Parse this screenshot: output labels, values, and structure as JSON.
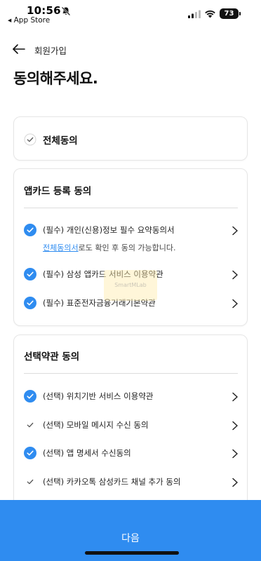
{
  "status_bar": {
    "time": "10:56",
    "back_app": "◂ App Store",
    "battery": "73"
  },
  "header": {
    "title": "회원가입"
  },
  "page": {
    "title": "동의해주세요."
  },
  "agree_all": {
    "label": "전체동의",
    "checked": false
  },
  "required_section": {
    "title": "앱카드 등록 동의",
    "items": [
      {
        "label": "(필수) 개인(신용)정보 필수 요약동의서",
        "checked": true
      },
      {
        "label": "(필수) 삼성 앱카드 서비스 이용약관",
        "checked": true
      },
      {
        "label": "(필수) 표준전자금융거래기본약관",
        "checked": true
      }
    ],
    "note_link": "전체동의서",
    "note_text": "로도 확인 후 동의 가능합니다."
  },
  "optional_section": {
    "title": "선택약관 동의",
    "items": [
      {
        "label": "(선택) 위치기반 서비스 이용약관",
        "checked": true
      },
      {
        "label": "(선택) 모바일 메시지 수신 동의",
        "checked": false
      },
      {
        "label": "(선택) 앱 명세서 수신동의",
        "checked": true
      },
      {
        "label": "(선택) 카카오톡 삼성카드 채널 추가 동의",
        "checked": false
      }
    ]
  },
  "footer": {
    "next_label": "다음"
  },
  "watermark": "SmartMLab",
  "colors": {
    "accent": "#2f8cf0",
    "card_border": "#e6e6e6",
    "text": "#111111"
  },
  "icons": {
    "back": "arrow-left-icon",
    "chevron": "chevron-right-icon",
    "check": "check-icon"
  }
}
